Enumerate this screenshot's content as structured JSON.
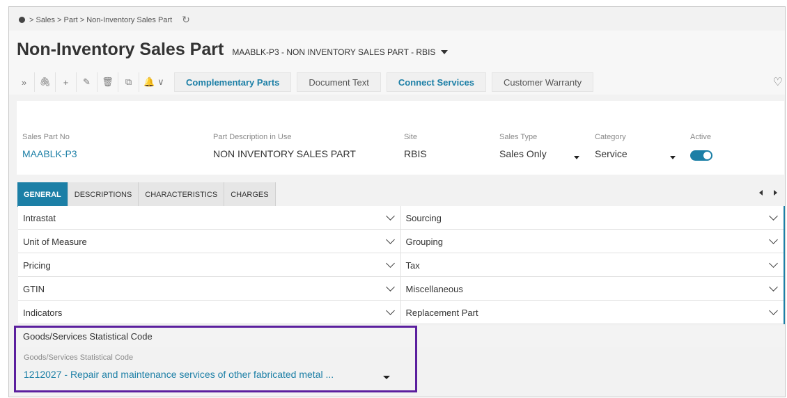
{
  "breadcrumb": {
    "home_icon": "dot-icon",
    "path": "> Sales > Part > Non-Inventory Sales Part",
    "refresh_icon": "refresh-icon"
  },
  "page": {
    "title": "Non-Inventory Sales Part",
    "subtitle": "MAABLK-P3 - NON INVENTORY SALES PART - RBIS"
  },
  "toolbar": {
    "icons": [
      "expand-icon",
      "attachment-icon",
      "add-icon",
      "edit-icon",
      "delete-icon",
      "copy-icon",
      "bell-icon"
    ],
    "buttons": {
      "complementary_parts": "Complementary Parts",
      "document_text": "Document Text",
      "connect_services": "Connect Services",
      "customer_warranty": "Customer Warranty"
    },
    "accent_color": "#1c7fa6"
  },
  "fields": {
    "sales_part_no": {
      "label": "Sales Part No",
      "value": "MAABLK-P3"
    },
    "part_description": {
      "label": "Part Description in Use",
      "value": "NON INVENTORY SALES PART"
    },
    "site": {
      "label": "Site",
      "value": "RBIS"
    },
    "sales_type": {
      "label": "Sales Type",
      "value": "Sales Only"
    },
    "category": {
      "label": "Category",
      "value": "Service"
    },
    "active": {
      "label": "Active",
      "value": true
    }
  },
  "tabs": [
    "GENERAL",
    "DESCRIPTIONS",
    "CHARACTERISTICS",
    "CHARGES"
  ],
  "groups": {
    "left": [
      "Intrastat",
      "Unit of Measure",
      "Pricing",
      "GTIN",
      "Indicators"
    ],
    "right": [
      "Sourcing",
      "Grouping",
      "Tax",
      "Miscellaneous",
      "Replacement Part"
    ]
  },
  "statistical": {
    "header": "Goods/Services Statistical Code",
    "label": "Goods/Services Statistical Code",
    "value": "1212027 - Repair and maintenance services of other fabricated metal ..."
  },
  "highlight_color": "#5b1f9e"
}
